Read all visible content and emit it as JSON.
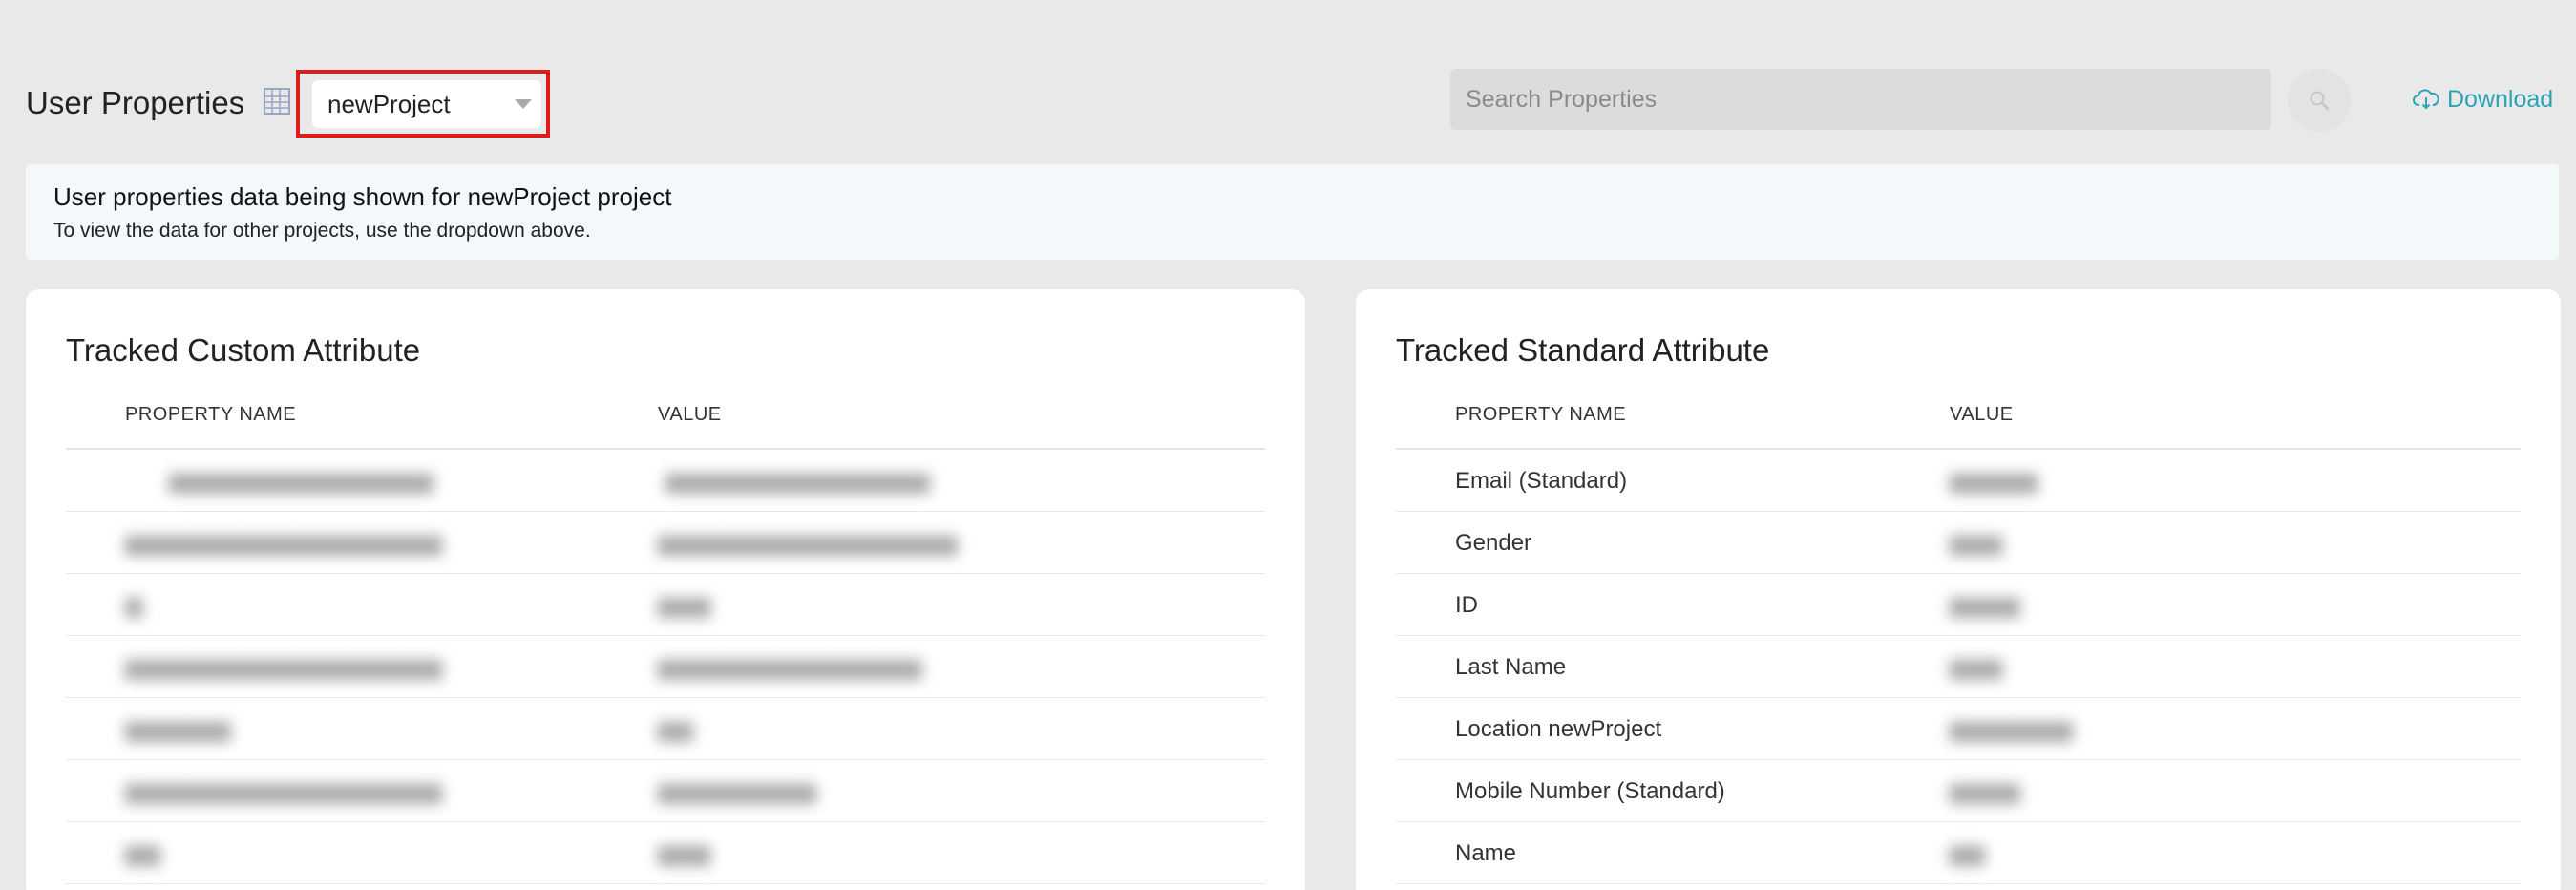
{
  "header": {
    "title": "User Properties",
    "project_select_value": "newProject",
    "search_placeholder": "Search Properties",
    "download_label": "Download"
  },
  "banner": {
    "title": "User properties data being shown for newProject project",
    "subtitle": "To view the data for other projects, use the dropdown above."
  },
  "custom_attributes": {
    "title": "Tracked Custom Attribute",
    "columns": [
      "PROPERTY NAME",
      "VALUE"
    ],
    "rows": [
      {
        "name": "",
        "value": ""
      },
      {
        "name": "",
        "value": ""
      },
      {
        "name": "",
        "value": ""
      },
      {
        "name": "",
        "value": ""
      },
      {
        "name": "",
        "value": ""
      },
      {
        "name": "",
        "value": ""
      },
      {
        "name": "",
        "value": ""
      }
    ]
  },
  "standard_attributes": {
    "title": "Tracked Standard Attribute",
    "columns": [
      "PROPERTY NAME",
      "VALUE"
    ],
    "rows": [
      {
        "name": "Email (Standard)",
        "value": ""
      },
      {
        "name": "Gender",
        "value": ""
      },
      {
        "name": "ID",
        "value": ""
      },
      {
        "name": "Last Name",
        "value": ""
      },
      {
        "name": "Location newProject",
        "value": ""
      },
      {
        "name": "Mobile Number (Standard)",
        "value": ""
      },
      {
        "name": "Name",
        "value": ""
      }
    ]
  },
  "colors": {
    "accent": "#2aa4b5",
    "highlight_border": "#e01b1b",
    "banner_bg": "#f3f8fb",
    "page_bg": "#e9e9e9"
  }
}
